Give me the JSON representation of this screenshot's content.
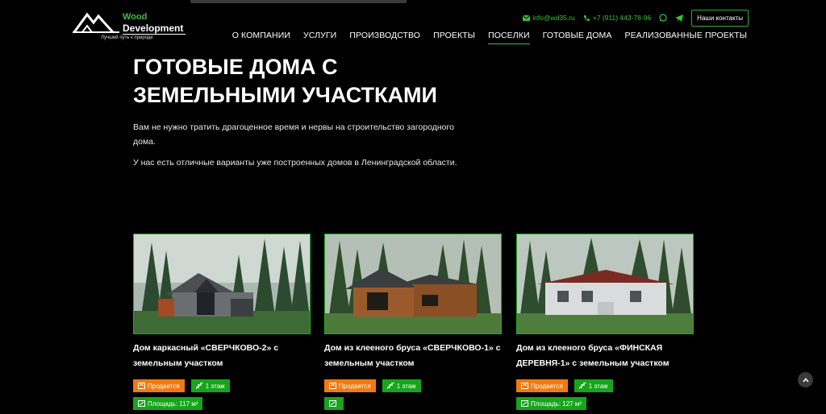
{
  "brand": {
    "name_line1": "Wood",
    "name_line2": "Development",
    "tagline": "Лучший путь к природе",
    "accent": "#3fbf3f"
  },
  "contacts": {
    "email": "info@wd35.ru",
    "phone": "+7 (911) 443-78-96",
    "whatsapp_icon": "whatsapp-icon",
    "telegram_icon": "telegram-icon",
    "button_label": "Наши контакты"
  },
  "nav": {
    "items": [
      {
        "label": "О КОМПАНИИ"
      },
      {
        "label": "УСЛУГИ"
      },
      {
        "label": "ПРОИЗВОДСТВО"
      },
      {
        "label": "ПРОЕКТЫ"
      },
      {
        "label": "ПОСЕЛКИ"
      },
      {
        "label": "ГОТОВЫЕ ДОМА"
      },
      {
        "label": "РЕАЛИЗОВАННЫЕ ПРОЕКТЫ"
      }
    ],
    "active_index": 4
  },
  "hero": {
    "title_line1": "ГОТОВЫЕ ДОМА С",
    "title_line2": "ЗЕМЕЛЬНЫМИ УЧАСТКАМИ",
    "paragraph1": "Вам не нужно тратить драгоценное время и нервы на строительство загородного дома.",
    "paragraph2": "У нас есть отличные варианты уже построенных домов в Ленинградской области."
  },
  "cards": [
    {
      "title": "Дом каркасный «СВЕРЧКОВО-2» с земельным участком",
      "status": "Продается",
      "floors": "1 этаж",
      "area": "Площадь: 117 м²",
      "colors": {
        "status": "#f07a10",
        "floors": "#16a51c"
      }
    },
    {
      "title": "Дом из клееного бруса «СВЕРЧКОВО-1» с земельным участком",
      "status": "Продается",
      "floors": "1 этаж",
      "area": "",
      "colors": {
        "status": "#f07a10",
        "floors": "#16a51c"
      }
    },
    {
      "title": "Дом из клееного бруса «ФИНСКАЯ ДЕРЕВНЯ-1» с земельным участком",
      "status": "Продается",
      "floors": "1 этаж",
      "area": "Площадь: 127 м²",
      "colors": {
        "status": "#f07a10",
        "floors": "#16a51c"
      }
    }
  ]
}
